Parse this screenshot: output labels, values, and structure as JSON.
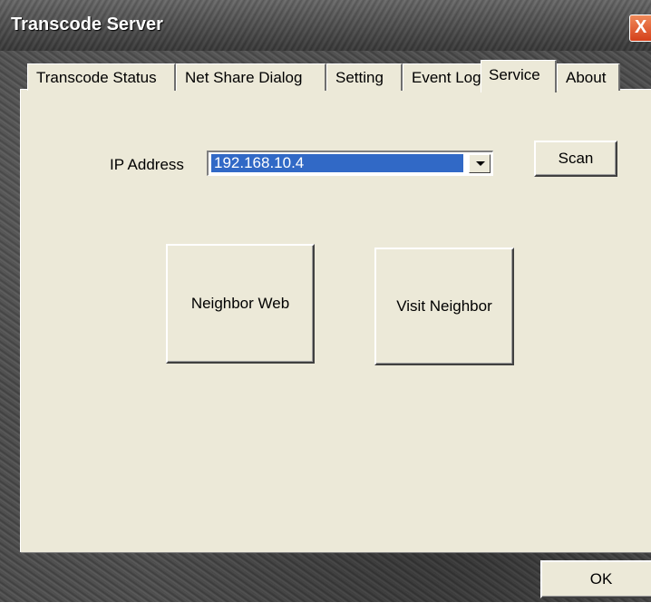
{
  "window": {
    "title": "Transcode Server",
    "close_label": "X"
  },
  "tabs": [
    {
      "label": "Transcode Status",
      "active": false
    },
    {
      "label": "Net Share Dialog",
      "active": false
    },
    {
      "label": "Setting",
      "active": false
    },
    {
      "label": "Event Log",
      "active": false
    },
    {
      "label": "Service",
      "active": true
    },
    {
      "label": "About",
      "active": false
    }
  ],
  "service": {
    "ip_label": "IP Address",
    "ip_value": "192.168.10.4",
    "scan_label": "Scan",
    "neighbor_web_label": "Neighbor Web",
    "visit_neighbor_label": "Visit Neighbor"
  },
  "footer": {
    "ok_label": "OK"
  },
  "colors": {
    "panel_bg": "#ece9d8",
    "selection": "#3169c6",
    "close_button": "#d5401a"
  }
}
